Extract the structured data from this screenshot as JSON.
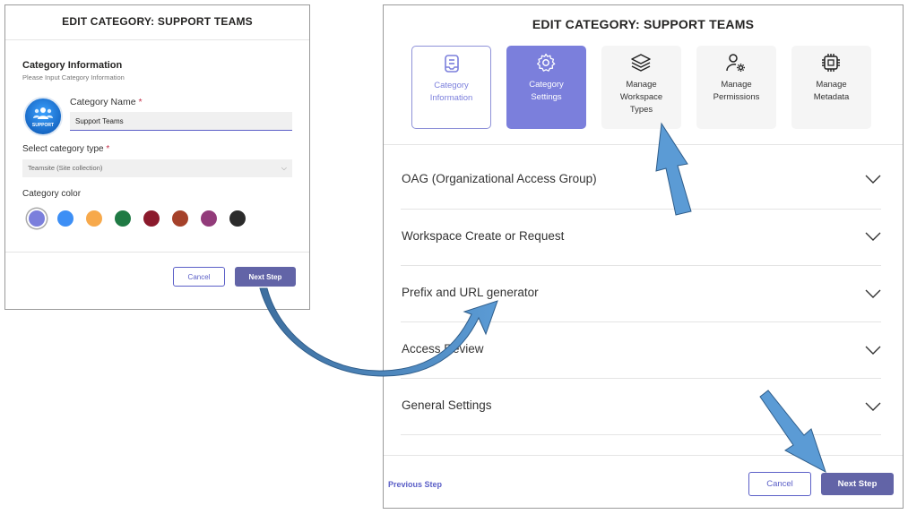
{
  "left": {
    "title": "EDIT CATEGORY: SUPPORT TEAMS",
    "section_title": "Category Information",
    "section_subtitle": "Please Input Category Information",
    "logo_text": "SUPPORT",
    "name_label": "Category Name",
    "required_mark": "*",
    "name_value": "Support Teams",
    "type_label": "Select category type",
    "type_value": "Teamsite (Site collection)",
    "color_label": "Category color",
    "colors": [
      "#7b7fdc",
      "#3d8ff5",
      "#f7a94b",
      "#1f7a44",
      "#8b1a2c",
      "#a5412a",
      "#923b7a",
      "#2b2b2b"
    ],
    "cancel_label": "Cancel",
    "next_label": "Next Step"
  },
  "right": {
    "title": "EDIT CATEGORY: SUPPORT TEAMS",
    "tiles": [
      {
        "line1": "Category",
        "line2": "Information",
        "line3": "",
        "icon": "form-icon",
        "state": "outlined"
      },
      {
        "line1": "Category",
        "line2": "Settings",
        "line3": "",
        "icon": "settings-icon",
        "state": "active"
      },
      {
        "line1": "Manage",
        "line2": "Workspace",
        "line3": "Types",
        "icon": "layers-icon",
        "state": "default"
      },
      {
        "line1": "Manage",
        "line2": "Permissions",
        "line3": "",
        "icon": "person-settings-icon",
        "state": "default"
      },
      {
        "line1": "Manage",
        "line2": "Metadata",
        "line3": "",
        "icon": "chip-icon",
        "state": "default"
      }
    ],
    "sections": [
      "OAG (Organizational Access Group)",
      "Workspace Create or Request",
      "Prefix and URL generator",
      "Access Review",
      "General Settings"
    ],
    "previous_label": "Previous Step",
    "cancel_label": "Cancel",
    "next_label": "Next Step"
  },
  "colors": {
    "accent": "#6264a7",
    "active_tile": "#7b7fdc",
    "arrow": "#5b9bd5"
  }
}
